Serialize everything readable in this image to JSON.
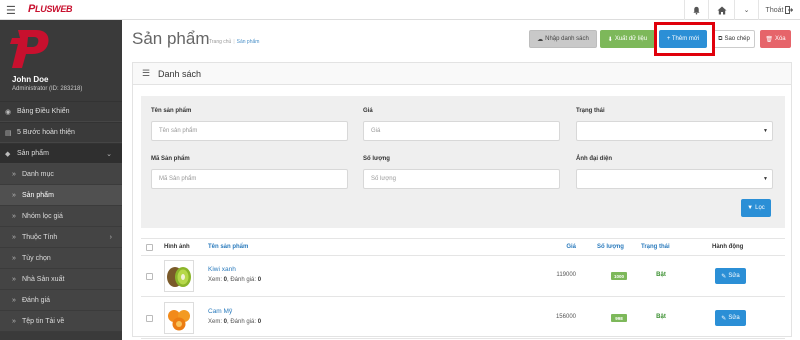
{
  "app": {
    "logo_p": "P",
    "logo_rest": "LUSWEB"
  },
  "topbar": {
    "menu_icon": "hamburger-icon",
    "logout_label": "Thoát"
  },
  "sidebar": {
    "user": {
      "name": "John Doe",
      "role": "Administrator (ID: 283218)"
    },
    "items": [
      {
        "label": "Bảng Điều Khiển",
        "icon": "dashboard-icon"
      },
      {
        "label": "5 Bước hoàn thiện",
        "icon": "document-icon"
      },
      {
        "label": "Sản phẩm",
        "icon": "tag-icon"
      }
    ],
    "sub_items": [
      {
        "label": "Danh mục"
      },
      {
        "label": "Sản phẩm"
      },
      {
        "label": "Nhóm lọc giá"
      },
      {
        "label": "Thuộc Tính"
      },
      {
        "label": "Tùy chọn"
      },
      {
        "label": "Nhà Sản xuất"
      },
      {
        "label": "Đánh giá"
      },
      {
        "label": "Tệp tin Tải về"
      }
    ]
  },
  "page": {
    "title": "Sản phẩm",
    "breadcrumb": {
      "home": "Trang chủ",
      "sep": "|",
      "current": "Sản phẩm"
    }
  },
  "toolbar": {
    "import_label": "Nhập danh sách",
    "export_label": "Xuất dữ liệu",
    "add_label": "+ Thêm mới",
    "copy_label": "Sao chép",
    "delete_label": "Xóa"
  },
  "panel": {
    "title": "Danh sách"
  },
  "filter": {
    "name_label": "Tên sản phẩm",
    "name_placeholder": "Tên sản phẩm",
    "price_label": "Giá",
    "price_placeholder": "Giá",
    "status_label": "Trạng thái",
    "code_label": "Mã Sản phẩm",
    "code_placeholder": "Mã Sản phẩm",
    "qty_label": "Số lượng",
    "qty_placeholder": "Số lượng",
    "image_label": "Ảnh đại diện",
    "filter_button": "Lọc"
  },
  "table": {
    "headers": {
      "image": "Hình ảnh",
      "name": "Tên sản phẩm",
      "price": "Giá",
      "qty": "Số lượng",
      "status": "Trạng thái",
      "action": "Hành động"
    },
    "rows": [
      {
        "name": "Kiwi xanh",
        "meta_prefix": "Xem: ",
        "views": "0",
        "meta_mid": ", Đánh giá: ",
        "reviews": "0",
        "price": "119000",
        "qty": "1000",
        "status": "Bật",
        "edit": "Sửa",
        "thumb": "kiwi"
      },
      {
        "name": "Cam Mỹ",
        "meta_prefix": "Xem: ",
        "views": "0",
        "meta_mid": ", Đánh giá: ",
        "reviews": "0",
        "price": "156000",
        "qty": "998",
        "status": "Bật",
        "edit": "Sửa",
        "thumb": "orange"
      }
    ]
  },
  "colors": {
    "brand": "#c8102e",
    "primary": "#2b8fd6",
    "success": "#7db85a",
    "danger": "#e6646a",
    "sidebar": "#3a3a3a",
    "highlight": "#e0000b"
  }
}
